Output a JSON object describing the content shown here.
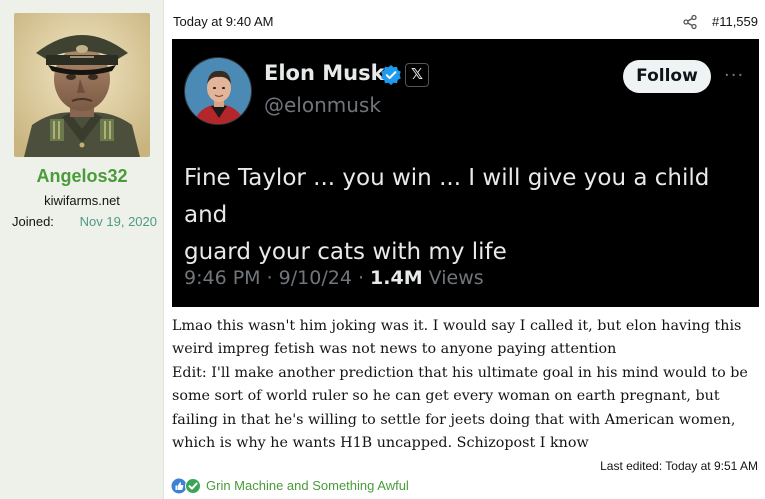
{
  "user": {
    "username": "Angelos32",
    "title": "kiwifarms.net",
    "joined_label": "Joined:",
    "joined_date": "Nov 19, 2020"
  },
  "post": {
    "time": "Today at 9:40 AM",
    "number": "#11,559",
    "body_lines": [
      "Lmao this wasn't him joking was it. I would say I called it, but elon having this",
      "weird impreg fetish was not news to anyone paying attention",
      "Edit: I'll make another prediction that his ultimate goal in his mind would to be",
      "some sort of world ruler so he can get every woman on earth pregnant, but",
      "failing in that he's willing to settle for jeets doing that with American women,",
      "which is why he wants H1B uncapped. Schizopost I know"
    ],
    "last_edited": "Last edited: Today at 9:51 AM",
    "reactions_text": "Grin Machine and Something Awful"
  },
  "tweet": {
    "name": "Elon Musk",
    "handle": "@elonmusk",
    "follow_label": "Follow",
    "more_label": "···",
    "x_badge": "𝕏",
    "text_lines": [
      "Fine Taylor ... you win ... I will give you a child and",
      "guard your cats with my life"
    ],
    "meta_time": "9:46 PM · 9/10/24 · ",
    "views_count": "1.4M",
    "views_label": " Views"
  },
  "colors": {
    "username": "#4a9b3a",
    "joined_date": "#4d9a86",
    "sidebar_bg": "#eef1ea",
    "tweet_bg": "#000000",
    "verified": "#1d9bf0",
    "reactions_link": "#4a9b3a"
  },
  "icons": {
    "share": "share-icon",
    "verified": "verified-badge-icon",
    "x_badge": "x-logo-icon",
    "more": "more-icon",
    "like": "like-reaction-icon",
    "check": "check-reaction-icon"
  }
}
